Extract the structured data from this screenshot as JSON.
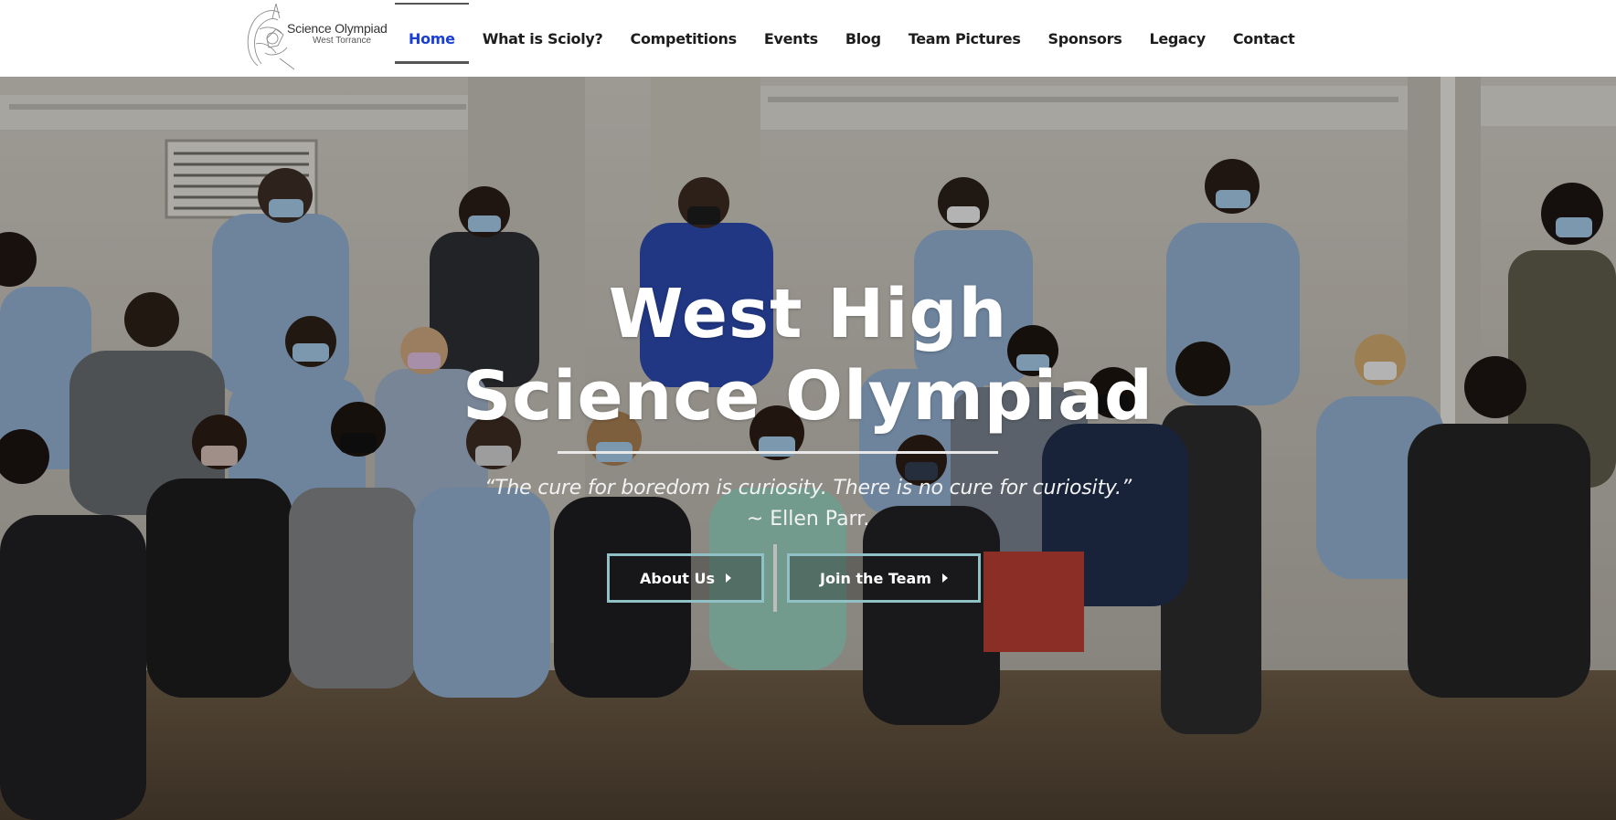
{
  "header": {
    "logo_title": "Science Olympiad",
    "logo_subtitle": "West Torrance",
    "nav": [
      {
        "label": "Home",
        "active": true
      },
      {
        "label": "What is Scioly?"
      },
      {
        "label": "Competitions"
      },
      {
        "label": "Events"
      },
      {
        "label": "Blog"
      },
      {
        "label": "Team Pictures"
      },
      {
        "label": "Sponsors"
      },
      {
        "label": "Legacy"
      },
      {
        "label": "Contact"
      }
    ]
  },
  "hero": {
    "title_line1": "West High",
    "title_line2": "Science Olympiad",
    "quote": "“The cure for boredom is curiosity. There is no cure for curiosity.”",
    "author": "~ Ellen Parr.",
    "buttons": {
      "about": "About Us",
      "join": "Join the Team"
    }
  },
  "colors": {
    "nav_active": "#1a3fd4",
    "button_border": "#8fc1c7",
    "hoodie_blue": "#8ea9c9"
  }
}
